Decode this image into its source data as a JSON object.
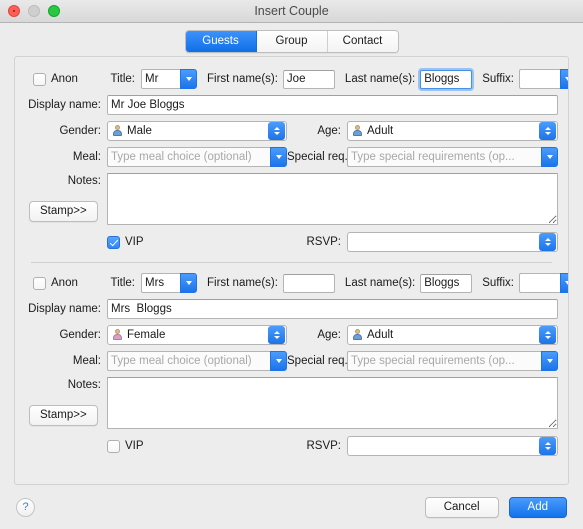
{
  "window": {
    "title": "Insert Couple",
    "traffic_lights": [
      "close",
      "minimize",
      "maximize"
    ]
  },
  "tabs": [
    {
      "label": "Guests",
      "selected": true
    },
    {
      "label": "Group",
      "selected": false
    },
    {
      "label": "Contact",
      "selected": false
    }
  ],
  "labels": {
    "anon": "Anon",
    "title": "Title:",
    "first_names": "First name(s):",
    "last_names": "Last name(s):",
    "suffix": "Suffix:",
    "display_name": "Display name:",
    "gender": "Gender:",
    "age": "Age:",
    "meal": "Meal:",
    "special_req": "Special req.:",
    "notes": "Notes:",
    "stamp": "Stamp>>",
    "vip": "VIP",
    "rsvp": "RSVP:"
  },
  "placeholders": {
    "meal": "Type meal choice (optional)",
    "special_req": "Type special requirements (op...",
    "first_names": "",
    "suffix": "",
    "rsvp": ""
  },
  "guests": [
    {
      "anon_checked": false,
      "title": "Mr",
      "first_names": "Joe",
      "last_names": "Bloggs",
      "last_names_focused": true,
      "suffix": "",
      "display_name": "Mr Joe Bloggs",
      "gender": "Male",
      "gender_icon": "person-male-icon",
      "age": "Adult",
      "age_icon": "person-adult-icon",
      "meal": "",
      "special_req": "",
      "notes": "",
      "vip_checked": true,
      "rsvp": ""
    },
    {
      "anon_checked": false,
      "title": "Mrs",
      "first_names": "",
      "last_names": "Bloggs",
      "last_names_focused": false,
      "suffix": "",
      "display_name": "Mrs  Bloggs",
      "gender": "Female",
      "gender_icon": "person-female-icon",
      "age": "Adult",
      "age_icon": "person-adult-icon",
      "meal": "",
      "special_req": "",
      "notes": "",
      "vip_checked": false,
      "rsvp": ""
    }
  ],
  "footer": {
    "help": "?",
    "cancel": "Cancel",
    "add": "Add"
  },
  "colors": {
    "accent": "#1272ec",
    "tab_selected": "#1f77f0",
    "window_bg": "#ececec",
    "panel_bg": "#ededed",
    "placeholder_text": "#a8a8a8"
  }
}
